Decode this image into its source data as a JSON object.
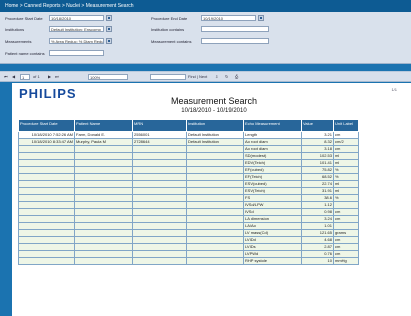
{
  "breadcrumb": "Home > Canned Reports > Nuclei > Measurement Search",
  "filters": {
    "start_label": "Procedure Start Date",
    "start_value": "10/18/2010",
    "end_label": "Procedure End Date",
    "end_value": "10/19/2010",
    "institutions_label": "Institutions",
    "institutions_value": "Default Institution; Enscomp",
    "inst_contains_label": "Institution contains",
    "measurements_label": "Measurements",
    "measurements_value": "% Area Reduc; % Diam Reduc",
    "meas_contains_label": "Measurement contains",
    "patient_label": "Patient name contains"
  },
  "toolbar": {
    "page": "1",
    "of": "of 1",
    "zoom": "100%",
    "find": "Find | Next"
  },
  "report": {
    "logo": "PHILIPS",
    "title": "Measurement Search",
    "range": "10/18/2010 - 10/19/2010",
    "columns": [
      "Procedure Start Date",
      "Patient Name",
      "MRN",
      "Institution",
      "Echo Measurement",
      "Value",
      "Unit Label"
    ],
    "rows": [
      [
        "10/18/2010 7:52:26 AM",
        "Farm, Donald E.",
        "2556001",
        "Default Institution",
        "Length",
        "3.21",
        "cm"
      ],
      [
        "10/18/2010 8:33:47 AM",
        "Murphy, Paula M",
        "2728644",
        "Default Institution",
        "Ao root diam",
        "8.32",
        "cm/2"
      ],
      [
        "",
        "",
        "",
        "",
        "Ao root diam",
        "3.18",
        "cm"
      ],
      [
        "",
        "",
        "",
        "",
        "SD(modest)",
        "102.53",
        "ml"
      ],
      [
        "",
        "",
        "",
        "",
        "EDV(Teich)",
        "101.41",
        "ml"
      ],
      [
        "",
        "",
        "",
        "",
        "EF(cubed)",
        "75.82",
        "%"
      ],
      [
        "",
        "",
        "",
        "",
        "EF(Teich)",
        "68.52",
        "%"
      ],
      [
        "",
        "",
        "",
        "",
        "ESV(cubed)",
        "22.74",
        "ml"
      ],
      [
        "",
        "",
        "",
        "",
        "ESV(Teich)",
        "31.91",
        "ml"
      ],
      [
        "",
        "",
        "",
        "",
        "FS",
        "38.6",
        "%"
      ],
      [
        "",
        "",
        "",
        "",
        "IVSd/LPW",
        "1.12",
        ""
      ],
      [
        "",
        "",
        "",
        "",
        "IVSd",
        "0.98",
        "cm"
      ],
      [
        "",
        "",
        "",
        "",
        "LA dimension",
        "3.24",
        "cm"
      ],
      [
        "",
        "",
        "",
        "",
        "LA/Ao",
        "1.01",
        ""
      ],
      [
        "",
        "",
        "",
        "",
        "LV mass(Cd)",
        "121.65",
        "grams"
      ],
      [
        "",
        "",
        "",
        "",
        "LVIDd",
        "4.68",
        "cm"
      ],
      [
        "",
        "",
        "",
        "",
        "LVIDs",
        "2.87",
        "cm"
      ],
      [
        "",
        "",
        "",
        "",
        "LVPWd",
        "0.76",
        "cm"
      ],
      [
        "",
        "",
        "",
        "",
        "RHP systole",
        "10",
        "mmHg"
      ]
    ]
  }
}
